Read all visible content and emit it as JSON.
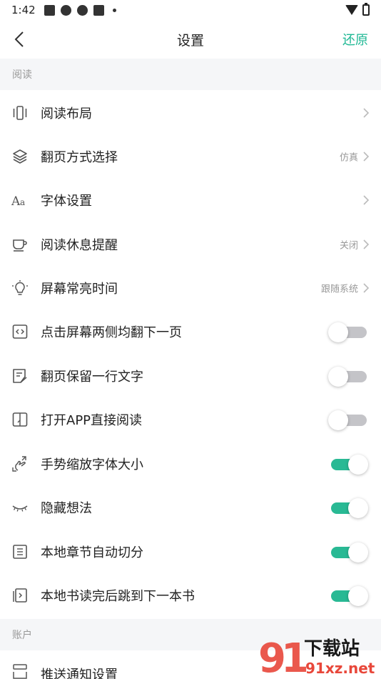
{
  "status_bar": {
    "time": "1:42"
  },
  "header": {
    "title": "设置",
    "reset_label": "还原"
  },
  "sections": {
    "reading": "阅读",
    "account": "账户"
  },
  "rows": {
    "layout": {
      "label": "阅读布局",
      "value": ""
    },
    "page_turn": {
      "label": "翻页方式选择",
      "value": "仿真"
    },
    "font": {
      "label": "字体设置",
      "value": ""
    },
    "rest_reminder": {
      "label": "阅读休息提醒",
      "value": "关闭"
    },
    "screen_on": {
      "label": "屏幕常亮时间",
      "value": "跟随系统"
    },
    "tap_both_sides": {
      "label": "点击屏幕两侧均翻下一页",
      "on": false
    },
    "keep_line": {
      "label": "翻页保留一行文字",
      "on": false
    },
    "open_direct": {
      "label": "打开APP直接阅读",
      "on": false
    },
    "pinch_zoom": {
      "label": "手势缩放字体大小",
      "on": true
    },
    "hide_thoughts": {
      "label": "隐藏想法",
      "on": true
    },
    "auto_chapter": {
      "label": "本地章节自动切分",
      "on": true
    },
    "jump_next_book": {
      "label": "本地书读完后跳到下一本书",
      "on": true
    },
    "push_notify": {
      "label": "推送通知设置"
    }
  },
  "colors": {
    "accent": "#29b994",
    "toggle_off": "#c4c4c8",
    "section_bg": "#f5f6f8"
  },
  "watermark": {
    "brand": "下载站",
    "domain": "91xz.net"
  }
}
